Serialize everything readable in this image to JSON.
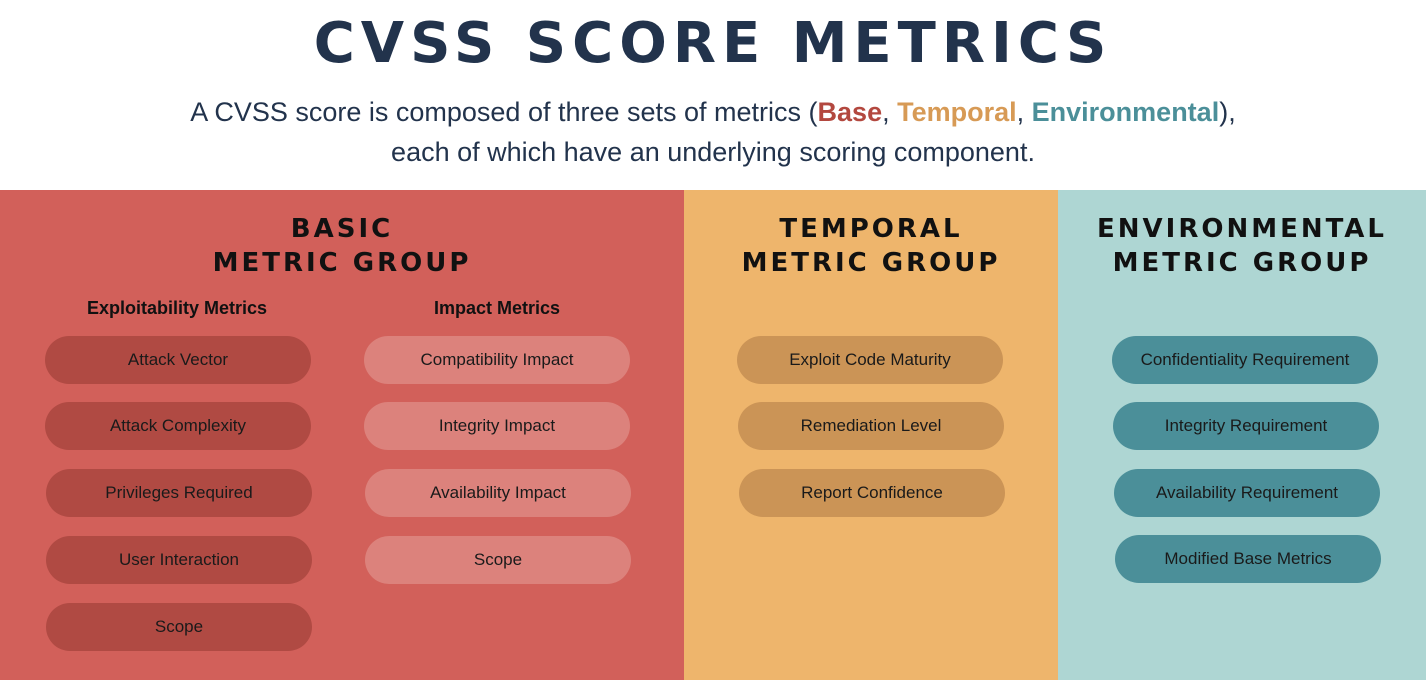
{
  "header": {
    "title": "CVSS SCORE METRICS",
    "subtitle": {
      "prefix": "A CVSS score is composed of three sets of metrics (",
      "base": "Base",
      "sep1": ", ",
      "temporal": "Temporal",
      "sep2": ", ",
      "environmental": "Environmental",
      "suffix": "),",
      "line2": "each of which have an underlying scoring component."
    }
  },
  "colors": {
    "title": "#22334c",
    "base": "#b3483f",
    "temporal": "#d79a55",
    "environmental": "#4b8f99",
    "base_panel": "#d2605a",
    "temporal_panel": "#eeb56c",
    "environmental_panel": "#aed6d3"
  },
  "groups": {
    "base": {
      "title_line1": "BASIC",
      "title_line2": "METRIC GROUP",
      "exploitability": {
        "heading": "Exploitability Metrics",
        "items": [
          "Attack Vector",
          "Attack Complexity",
          "Privileges Required",
          "User Interaction",
          "Scope"
        ]
      },
      "impact": {
        "heading": "Impact Metrics",
        "items": [
          "Compatibility Impact",
          "Integrity Impact",
          "Availability Impact",
          "Scope"
        ]
      }
    },
    "temporal": {
      "title_line1": "TEMPORAL",
      "title_line2": "METRIC GROUP",
      "items": [
        "Exploit Code Maturity",
        "Remediation Level",
        "Report Confidence"
      ]
    },
    "environmental": {
      "title_line1": "ENVIRONMENTAL",
      "title_line2": "METRIC GROUP",
      "items": [
        "Confidentiality Requirement",
        "Integrity Requirement",
        "Availability Requirement",
        "Modified Base Metrics"
      ]
    }
  }
}
